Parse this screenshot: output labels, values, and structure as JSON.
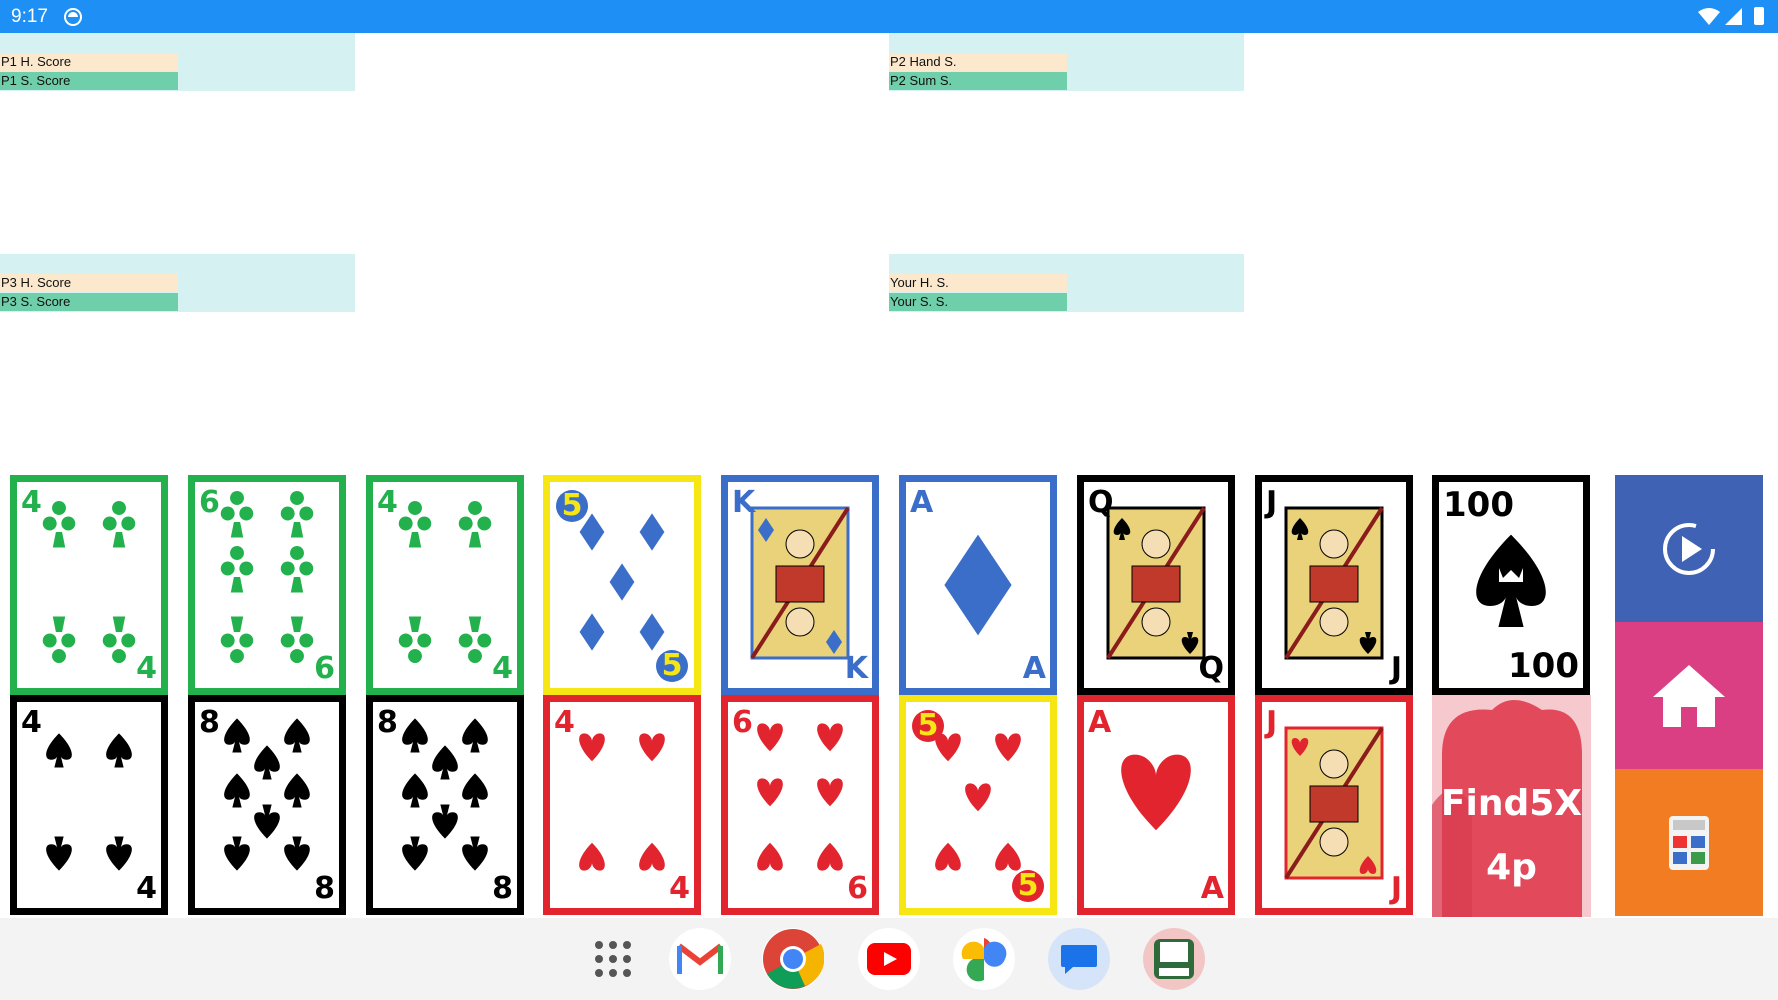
{
  "status_bar": {
    "time": "9:17"
  },
  "panels": {
    "p1": {
      "hand": "P1 H. Score",
      "sum": "P1 S. Score"
    },
    "p2": {
      "hand": "P2 Hand S.",
      "sum": "P2 Sum S."
    },
    "p3": {
      "hand": "P3 H. Score",
      "sum": "P3 S. Score"
    },
    "you": {
      "hand": "Your H. S.",
      "sum": "Your S. S."
    }
  },
  "cards_top": [
    {
      "rank": "4",
      "suit": "clubs",
      "frame": "green"
    },
    {
      "rank": "6",
      "suit": "clubs",
      "frame": "green"
    },
    {
      "rank": "4",
      "suit": "clubs",
      "frame": "green"
    },
    {
      "rank": "5",
      "suit": "diamonds",
      "frame": "yellow"
    },
    {
      "rank": "K",
      "suit": "diamonds",
      "frame": "blue"
    },
    {
      "rank": "A",
      "suit": "diamonds",
      "frame": "blue"
    },
    {
      "rank": "Q",
      "suit": "spades",
      "frame": "black"
    },
    {
      "rank": "J",
      "suit": "spades",
      "frame": "black"
    },
    {
      "rank": "100",
      "suit": "spades",
      "frame": "black"
    }
  ],
  "cards_bottom": [
    {
      "rank": "4",
      "suit": "spades",
      "frame": "black"
    },
    {
      "rank": "8",
      "suit": "spades",
      "frame": "black"
    },
    {
      "rank": "8",
      "suit": "spades",
      "frame": "black"
    },
    {
      "rank": "4",
      "suit": "hearts",
      "frame": "red"
    },
    {
      "rank": "6",
      "suit": "hearts",
      "frame": "red"
    },
    {
      "rank": "5",
      "suit": "hearts",
      "frame": "yellow"
    },
    {
      "rank": "A",
      "suit": "hearts",
      "frame": "red"
    },
    {
      "rank": "J",
      "suit": "hearts",
      "frame": "red"
    }
  ],
  "logo_card": {
    "line1": "Find5X",
    "line2": "4p"
  },
  "side_buttons": [
    "play-icon",
    "home-icon",
    "calculator-icon"
  ],
  "dock": [
    "apps-grid-icon",
    "gmail-icon",
    "chrome-icon",
    "youtube-icon",
    "photos-icon",
    "messages-icon",
    "find5x-app-icon"
  ],
  "colors": {
    "status_bar": "#1e90f5",
    "panel_bg": "#d6f1f1",
    "hand_row": "#fce9cd",
    "sum_row": "#6fcfab",
    "play_btn": "#3f62b5",
    "home_btn": "#db3f83",
    "calc_btn": "#f27c22"
  }
}
